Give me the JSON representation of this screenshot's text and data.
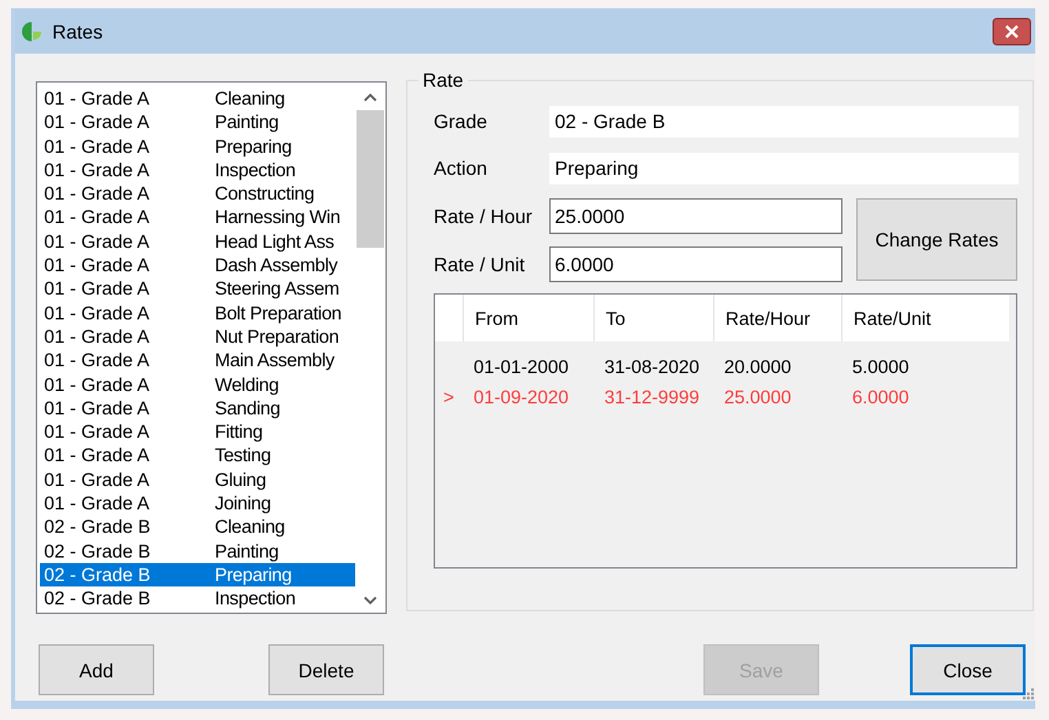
{
  "window": {
    "title": "Rates"
  },
  "list": {
    "items": [
      {
        "grade": "01 - Grade A",
        "action": "Cleaning",
        "selected": false
      },
      {
        "grade": "01 - Grade A",
        "action": "Painting",
        "selected": false
      },
      {
        "grade": "01 - Grade A",
        "action": "Preparing",
        "selected": false
      },
      {
        "grade": "01 - Grade A",
        "action": "Inspection",
        "selected": false
      },
      {
        "grade": "01 - Grade A",
        "action": "Constructing",
        "selected": false
      },
      {
        "grade": "01 - Grade A",
        "action": "Harnessing Win",
        "selected": false
      },
      {
        "grade": "01 - Grade A",
        "action": "Head Light Ass",
        "selected": false
      },
      {
        "grade": "01 - Grade A",
        "action": "Dash Assembly",
        "selected": false
      },
      {
        "grade": "01 - Grade A",
        "action": "Steering Assem",
        "selected": false
      },
      {
        "grade": "01 - Grade A",
        "action": "Bolt Preparation",
        "selected": false
      },
      {
        "grade": "01 - Grade A",
        "action": "Nut Preparation",
        "selected": false
      },
      {
        "grade": "01 - Grade A",
        "action": "Main Assembly",
        "selected": false
      },
      {
        "grade": "01 - Grade A",
        "action": "Welding",
        "selected": false
      },
      {
        "grade": "01 - Grade A",
        "action": "Sanding",
        "selected": false
      },
      {
        "grade": "01 - Grade A",
        "action": "Fitting",
        "selected": false
      },
      {
        "grade": "01 - Grade A",
        "action": "Testing",
        "selected": false
      },
      {
        "grade": "01 - Grade A",
        "action": "Gluing",
        "selected": false
      },
      {
        "grade": "01 - Grade A",
        "action": "Joining",
        "selected": false
      },
      {
        "grade": "02 - Grade B",
        "action": "Cleaning",
        "selected": false
      },
      {
        "grade": "02 - Grade B",
        "action": "Painting",
        "selected": false
      },
      {
        "grade": "02 - Grade B",
        "action": "Preparing",
        "selected": true
      },
      {
        "grade": "02 - Grade B",
        "action": "Inspection",
        "selected": false
      }
    ]
  },
  "rate_group": {
    "title": "Rate",
    "grade": {
      "label": "Grade",
      "value": "02 - Grade B"
    },
    "action": {
      "label": "Action",
      "value": "Preparing"
    },
    "rate_hour": {
      "label": "Rate / Hour",
      "value": "25.0000"
    },
    "rate_unit": {
      "label": "Rate / Unit",
      "value": "6.0000"
    },
    "change_button": "Change Rates",
    "grid": {
      "columns": [
        "From",
        "To",
        "Rate/Hour",
        "Rate/Unit"
      ],
      "rows": [
        {
          "cells": [
            "01-01-2000",
            "31-08-2020",
            "20.0000",
            "5.0000"
          ],
          "current": false
        },
        {
          "marker": ">",
          "cells": [
            "01-09-2020",
            "31-12-9999",
            "25.0000",
            "6.0000"
          ],
          "current": true
        }
      ]
    }
  },
  "buttons": [
    {
      "label": "Add",
      "disabled": false,
      "focused": false
    },
    {
      "label": "Delete",
      "disabled": false,
      "focused": false
    },
    {
      "label": "Save",
      "disabled": true,
      "focused": false
    },
    {
      "label": "Close",
      "disabled": false,
      "focused": true
    }
  ]
}
